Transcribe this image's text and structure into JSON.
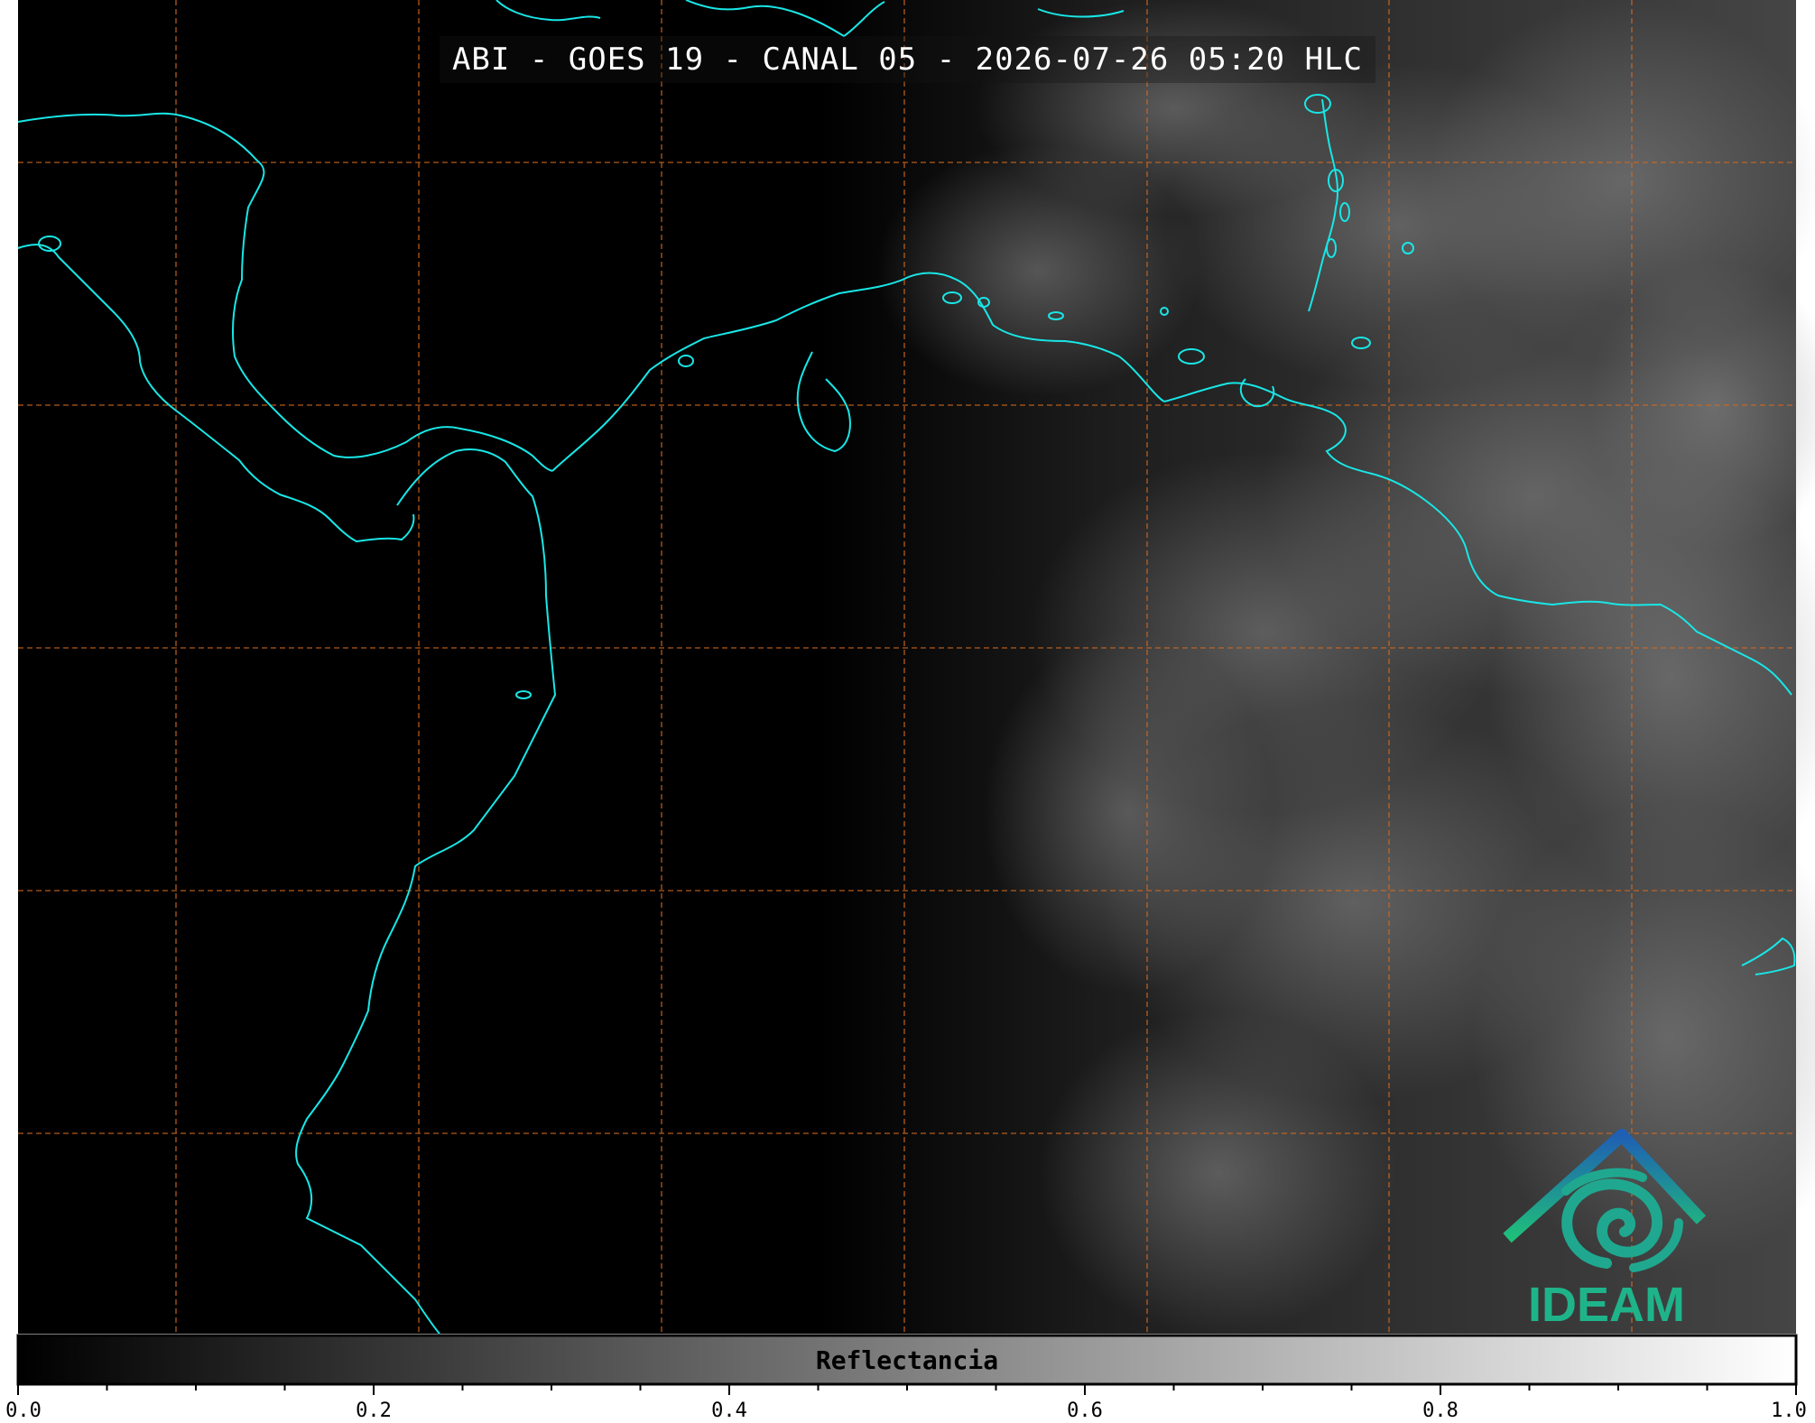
{
  "title": "ABI - GOES 19 - CANAL 05 - 2026-07-26 05:20 HLC",
  "colorbar": {
    "label": "Reflectancia",
    "ticks": [
      "0.0",
      "0.2",
      "0.4",
      "0.6",
      "0.8",
      "1.0"
    ],
    "min": 0.0,
    "max": 1.0
  },
  "logo": {
    "text": "IDEAM"
  },
  "colors": {
    "coastline": "#19e6e6",
    "gridlines": "#d2691e",
    "background": "#000000",
    "logo_blue": "#1f6fb4",
    "logo_green": "#1fb38a"
  },
  "icons": {
    "logo": "ideam-logo-icon"
  }
}
